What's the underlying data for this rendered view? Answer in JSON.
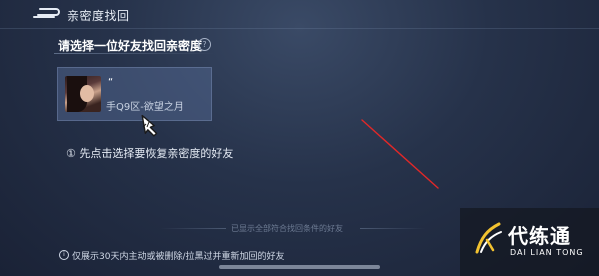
{
  "header": {
    "title": "亲密度找回"
  },
  "prompt": {
    "text": "请选择一位好友找回亲密度",
    "help_glyph": "?"
  },
  "friend": {
    "nickname": "“",
    "server": "手Q9区-欲望之月"
  },
  "instruction": {
    "text": "① 先点击选择要恢复亲密度的好友"
  },
  "footer": {
    "text": "已显示全部符合找回条件的好友"
  },
  "bottom_note": {
    "icon_glyph": "i",
    "text": "仅展示30天内主动或被删除/拉黑过并重新加回的好友"
  },
  "watermark": {
    "name": "代练通",
    "sub": "DAI LIAN TONG"
  },
  "colors": {
    "annotation_red": "#e02828",
    "brand_yellow": "#f2c230"
  }
}
